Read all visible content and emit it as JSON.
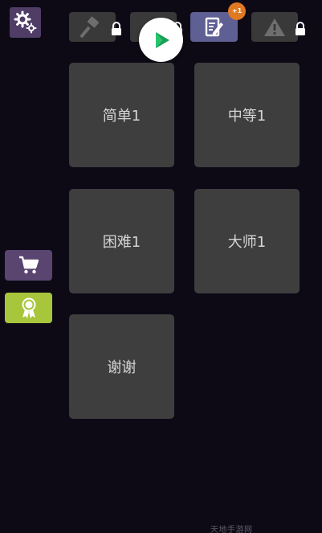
{
  "tabs": {
    "hammer": {
      "icon": "hammer-icon",
      "locked": true
    },
    "blank": {
      "icon": "",
      "locked": true
    },
    "edit": {
      "icon": "edit-document-icon",
      "locked": false,
      "badge": "+1"
    },
    "warning": {
      "icon": "warning-icon",
      "locked": true
    }
  },
  "levels": [
    {
      "label": "简单1"
    },
    {
      "label": "中等1"
    },
    {
      "label": "困难1"
    },
    {
      "label": "大师1"
    },
    {
      "label": "谢谢"
    }
  ],
  "side_buttons": {
    "shop_icon": "cart-icon",
    "award_icon": "award-ribbon-icon"
  },
  "play_icon": "play-icon",
  "settings_icon": "gears-icon",
  "watermark": "天地手游网",
  "colors": {
    "background": "#0d0a16",
    "tile": "#3e3e3e",
    "settings": "#4f3d66",
    "tab_active": "#5e5f93",
    "shop": "#5a4570",
    "award": "#a7c63b",
    "badge": "#e07922",
    "play_green": "#1a9e55"
  }
}
